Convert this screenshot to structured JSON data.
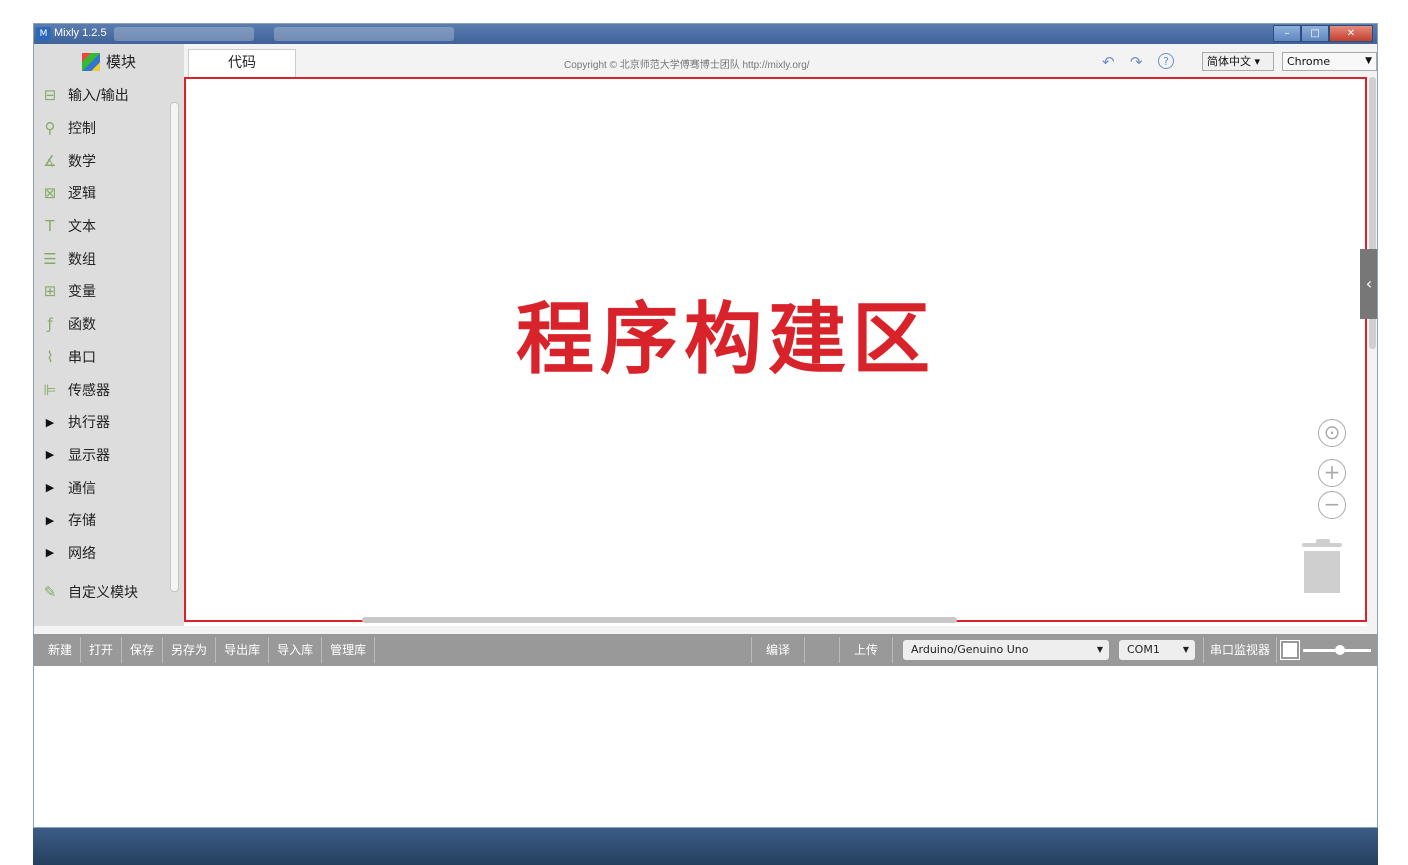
{
  "window": {
    "title": "Mixly 1.2.5",
    "icon_label": "M"
  },
  "sidebar": {
    "header": "模块",
    "categories": [
      {
        "label": "输入/输出",
        "icon": "io-icon",
        "glyph": "⊟"
      },
      {
        "label": "控制",
        "icon": "control-icon",
        "glyph": "⚲"
      },
      {
        "label": "数学",
        "icon": "math-icon",
        "glyph": "∡"
      },
      {
        "label": "逻辑",
        "icon": "logic-icon",
        "glyph": "⊠"
      },
      {
        "label": "文本",
        "icon": "text-icon",
        "glyph": "T"
      },
      {
        "label": "数组",
        "icon": "array-icon",
        "glyph": "☰"
      },
      {
        "label": "变量",
        "icon": "variable-icon",
        "glyph": "⊞"
      },
      {
        "label": "函数",
        "icon": "function-icon",
        "glyph": "ƒ"
      },
      {
        "label": "串口",
        "icon": "serial-icon",
        "glyph": "⌇"
      },
      {
        "label": "传感器",
        "icon": "sensor-icon",
        "glyph": "⊫"
      },
      {
        "label": "执行器",
        "icon": "expand-triangle-icon",
        "glyph": "▶"
      },
      {
        "label": "显示器",
        "icon": "expand-triangle-icon",
        "glyph": "▶"
      },
      {
        "label": "通信",
        "icon": "expand-triangle-icon",
        "glyph": "▶"
      },
      {
        "label": "存储",
        "icon": "expand-triangle-icon",
        "glyph": "▶"
      },
      {
        "label": "网络",
        "icon": "expand-triangle-icon",
        "glyph": "▶"
      },
      {
        "label": "自定义模块",
        "icon": "custom-block-icon",
        "glyph": "✎"
      }
    ]
  },
  "tabs": {
    "code": "代码"
  },
  "header": {
    "copyright": "Copyright © 北京师范大学傅骞博士团队 http://mixly.org/",
    "language": "简体中文 ▾",
    "browser": "Chrome"
  },
  "workspace": {
    "label": "程序构建区"
  },
  "toolbar": {
    "new": "新建",
    "open": "打开",
    "save": "保存",
    "save_as": "另存为",
    "export_lib": "导出库",
    "import_lib": "导入库",
    "manage_lib": "管理库",
    "compile": "编译",
    "upload": "上传",
    "board": "Arduino/Genuino Uno",
    "port": "COM1",
    "serial_monitor": "串口监视器"
  },
  "colors": {
    "accent_red": "#d9232b",
    "toolbar_gray": "#999999",
    "sidebar_bg": "#dddddd"
  }
}
